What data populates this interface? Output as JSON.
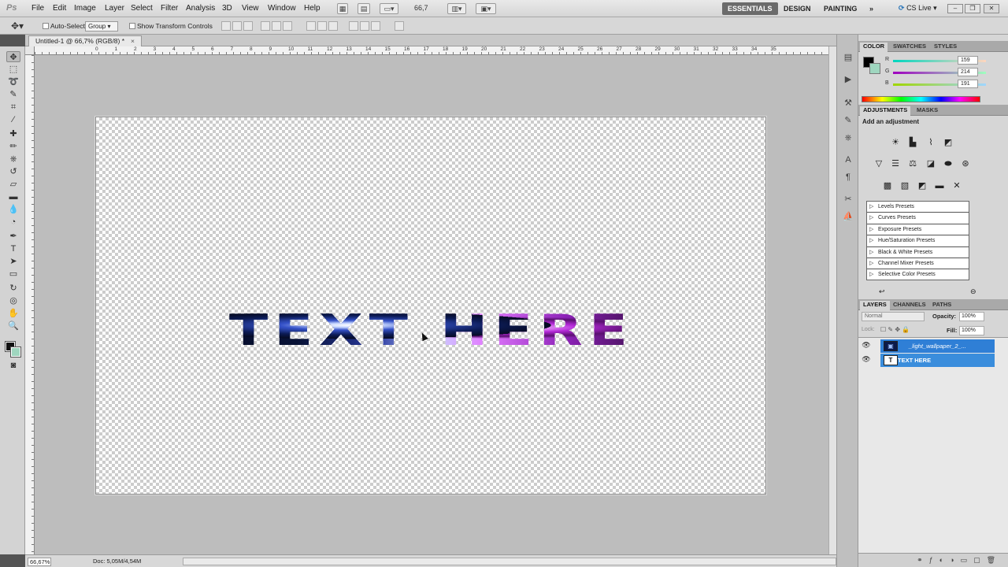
{
  "app": {
    "logo": "Ps"
  },
  "menu": {
    "items": [
      "File",
      "Edit",
      "Image",
      "Layer",
      "Select",
      "Filter",
      "Analysis",
      "3D",
      "View",
      "Window",
      "Help"
    ],
    "zoom": "66,7"
  },
  "workspaces": {
    "items": [
      "ESSENTIALS",
      "DESIGN",
      "PAINTING"
    ],
    "more": "»",
    "cslive": "CS Live"
  },
  "options": {
    "auto_select_label": "Auto-Select:",
    "auto_select_value": "Group",
    "transform_label": "Show Transform Controls"
  },
  "document": {
    "tab_title": "Untitled-1 @ 66,7% (RGB/8) *",
    "close": "×",
    "canvas_text": "TEXT HERE"
  },
  "ruler": {
    "top_numbers": [
      "0",
      "1",
      "2",
      "3",
      "4",
      "5",
      "6",
      "7",
      "8",
      "9",
      "10",
      "11",
      "12",
      "13",
      "14",
      "15",
      "16",
      "17",
      "18",
      "19",
      "20",
      "21",
      "22",
      "23",
      "24",
      "25",
      "26",
      "27",
      "28",
      "29",
      "30",
      "31",
      "32",
      "33",
      "34",
      "35"
    ]
  },
  "status": {
    "zoom": "66,67%",
    "doc": "Doc: 5,05M/4,54M"
  },
  "color_panel": {
    "tabs": [
      "COLOR",
      "SWATCHES",
      "STYLES"
    ],
    "r_label": "R",
    "g_label": "G",
    "b_label": "B",
    "r": "159",
    "g": "214",
    "b": "191",
    "fg_color": "#000000",
    "bg_color": "#9fd6bf"
  },
  "adjustments_panel": {
    "tabs": [
      "ADJUSTMENTS",
      "MASKS"
    ],
    "heading": "Add an adjustment",
    "presets": [
      "Levels Presets",
      "Curves Presets",
      "Exposure Presets",
      "Hue/Saturation Presets",
      "Black & White Presets",
      "Channel Mixer Presets",
      "Selective Color Presets"
    ]
  },
  "layers_panel": {
    "tabs": [
      "LAYERS",
      "CHANNELS",
      "PATHS"
    ],
    "blend_mode": "Normal",
    "opacity_label": "Opacity:",
    "opacity": "100%",
    "lock_label": "Lock:",
    "fill_label": "Fill:",
    "fill": "100%",
    "layers": [
      {
        "name": "_light_wallpaper_2_...",
        "thumb": "▣"
      },
      {
        "name": "TEXT HERE",
        "thumb": "T"
      }
    ]
  }
}
